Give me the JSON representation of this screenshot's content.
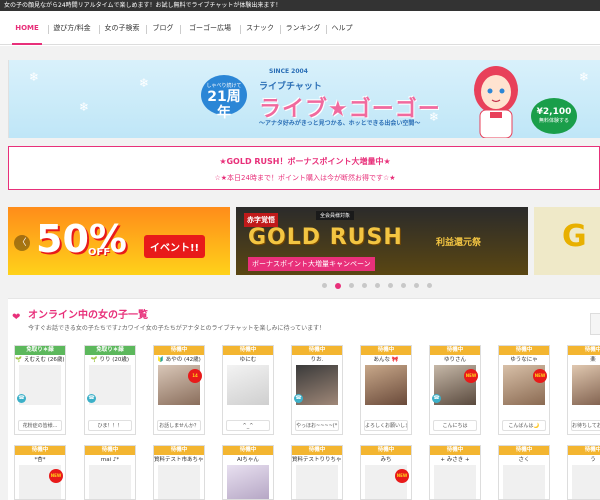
{
  "topbar": {
    "text": "女の子の顔見ながら24時間リアルタイムで楽しめます！お試し無料でライブチャットが体験出来ます！"
  },
  "nav": {
    "items": [
      {
        "label": "HOME",
        "active": true
      },
      {
        "label": "遊び方/料金",
        "active": false
      },
      {
        "label": "女の子検索",
        "active": false
      },
      {
        "label": "ブログ",
        "active": false
      },
      {
        "label": "ゴーゴー広場",
        "active": false
      },
      {
        "label": "スナック",
        "active": false
      },
      {
        "label": "ランキング",
        "active": false
      },
      {
        "label": "ヘルプ",
        "active": false
      }
    ]
  },
  "banner": {
    "badge_small": "しゃべり続けて",
    "badge_years": "21周年",
    "since": "SINCE 2004",
    "subtitle": "ライブチャット",
    "title": "ライブ★ゴーゴー",
    "tagline": "～アナタ好みがきっと見つかる、ホッとできる出会い空間～",
    "price": "¥2,100",
    "price_note": "無料体験する"
  },
  "notice": {
    "title": "★GOLD RUSH！ボーナスポイント大増量中★",
    "text": "☆★本日24時まで！ポイント購入は今が断然お得です☆★"
  },
  "carousel": {
    "slide_a": {
      "percent": "50%",
      "off": "OFF",
      "event": "イベント!!"
    },
    "slide_b": {
      "tag": "全会員様対象",
      "title": "GOLD RUSH",
      "bonus": "ボーナスポイント大増量キャンペーン",
      "red_tag": "赤字覚悟",
      "refund": "利益還元祭"
    },
    "slide_c": {
      "letter": "G"
    },
    "prev": "〈",
    "dot_count": 9,
    "active_dot": 1
  },
  "online": {
    "title": "オンライン中の女の子一覧",
    "desc": "今すぐお話できる女の子たちです♪カワイイ女の子たちがアナタとのライブチャットを楽しみに待っています！",
    "side_tab": "",
    "cards_row1": [
      {
        "status": "免取り＊緑",
        "name": "🌱 えむえむ (26歳)",
        "msg": "花粉症の皆様...",
        "color": "green"
      },
      {
        "status": "免取り＊緑",
        "name": "🌱 りり (20歳)",
        "msg": "ひま！！！",
        "color": "green"
      },
      {
        "status": "待機中",
        "name": "🔰 あやの (42歳)",
        "msg": "お話しませんか？",
        "color": "yellow"
      },
      {
        "status": "待機中",
        "name": "ゆにむ",
        "msg": "^_^",
        "color": "yellow"
      },
      {
        "status": "待機中",
        "name": "りお.",
        "msg": "やっほお~~~~(*^○^)",
        "color": "yellow"
      },
      {
        "status": "待機中",
        "name": "あんな 🎀",
        "msg": "よろしくお願いします",
        "color": "yellow"
      },
      {
        "status": "待機中",
        "name": "ゆりさん",
        "msg": "こんにちは",
        "color": "yellow"
      },
      {
        "status": "待機中",
        "name": "ゆうなにゃ",
        "msg": "こんばんは🌙",
        "color": "yellow"
      },
      {
        "status": "待機中",
        "name": "楽",
        "msg": "お待ちしております",
        "color": "yellow"
      }
    ],
    "cards_row2": [
      {
        "status": "待機中",
        "name": "*杏*",
        "color": "yellow"
      },
      {
        "status": "待機中",
        "name": "mai ♪*",
        "color": "yellow"
      },
      {
        "status": "待機中",
        "name": "質料テスト市あちゃん",
        "color": "yellow"
      },
      {
        "status": "待機中",
        "name": "AIちゃん",
        "color": "yellow"
      },
      {
        "status": "待機中",
        "name": "質料テストりりちゃん",
        "color": "yellow"
      },
      {
        "status": "待機中",
        "name": "みち",
        "color": "yellow"
      },
      {
        "status": "待機中",
        "name": "+ みさき +",
        "color": "yellow"
      },
      {
        "status": "待機中",
        "name": "さく",
        "color": "yellow"
      },
      {
        "status": "待機中",
        "name": "う",
        "color": "yellow"
      }
    ]
  },
  "colors": {
    "accent": "#e8307a",
    "status_green": "#5cb85c",
    "status_yellow": "#f3b530"
  }
}
